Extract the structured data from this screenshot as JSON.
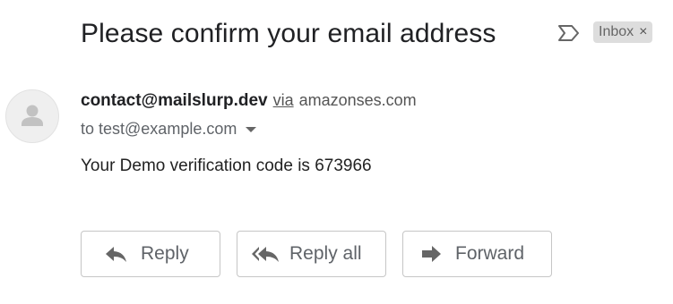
{
  "message": {
    "subject": "Please confirm your email address",
    "label": "Inbox",
    "label_close": "×",
    "sender_email": "contact@mailslurp.dev",
    "via_text": "via",
    "via_domain": "amazonses.com",
    "to_label": "to",
    "recipient": "test@example.com",
    "body": "Your Demo verification code is 673966"
  },
  "actions": {
    "reply": "Reply",
    "reply_all": "Reply all",
    "forward": "Forward"
  },
  "icons": {
    "importance": "importance-marker-icon",
    "avatar": "person-avatar-icon",
    "dropdown": "chevron-down-icon",
    "reply": "reply-icon",
    "reply_all": "reply-all-icon",
    "forward": "forward-icon"
  },
  "colors": {
    "text": "#202124",
    "secondary_text": "#5f6368",
    "chip_bg": "#dddddd",
    "button_border": "#c6c6c6",
    "icon": "#666666"
  }
}
